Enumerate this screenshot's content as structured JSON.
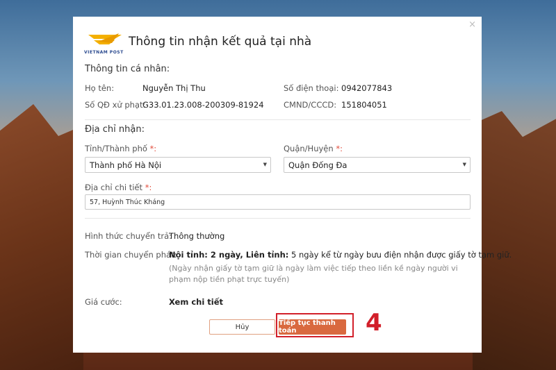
{
  "modal": {
    "brand_text": "VIETNAM POST",
    "title": "Thông tin nhận kết quả tại nhà",
    "close_glyph": "×"
  },
  "personal": {
    "section_title": "Thông tin cá nhân:",
    "fullname_label": "Họ tên:",
    "fullname_value": "Nguyễn Thị Thu",
    "phone_label": "Số điện thoại:",
    "phone_value": "0942077843",
    "decision_label": "Số QĐ xử phạt:",
    "decision_value": "G33.01.23.008-200309-81924",
    "id_label": "CMND/CCCD:",
    "id_value": "151804051"
  },
  "address": {
    "section_title": "Địa chỉ nhận:",
    "province_label": "Tỉnh/Thành phố",
    "province_value": "Thành phố Hà Nội",
    "district_label": "Quận/Huyện",
    "district_value": "Quận Đống Đa",
    "detail_label": "Địa chỉ chi tiết",
    "detail_value": "57, Huỳnh Thúc Kháng",
    "required_mark": "*:"
  },
  "delivery": {
    "method_label": "Hình thức chuyển trả:",
    "method_value": "Thông thường",
    "time_label": "Thời gian chuyển phát:",
    "time_inner_bold": "Nội tỉnh: 2 ngày, Liên tỉnh:",
    "time_rest": " 5 ngày kể từ ngày bưu điện nhận được giấy tờ tạm giữ.",
    "time_note": "(Ngày nhận giấy tờ tạm giữ là ngày làm việc tiếp theo liền kề ngày người vi phạm nộp tiền phạt trực tuyến)",
    "fee_label": "Giá cước:",
    "fee_value": "Xem chi tiết"
  },
  "actions": {
    "cancel_label": "Hủy",
    "pay_label": "Tiếp tục thanh toán"
  },
  "annotation": {
    "step_number": "4",
    "highlight_color": "#d21f2a"
  },
  "colors": {
    "accent": "#d9693f",
    "required": "#e14b3a"
  }
}
